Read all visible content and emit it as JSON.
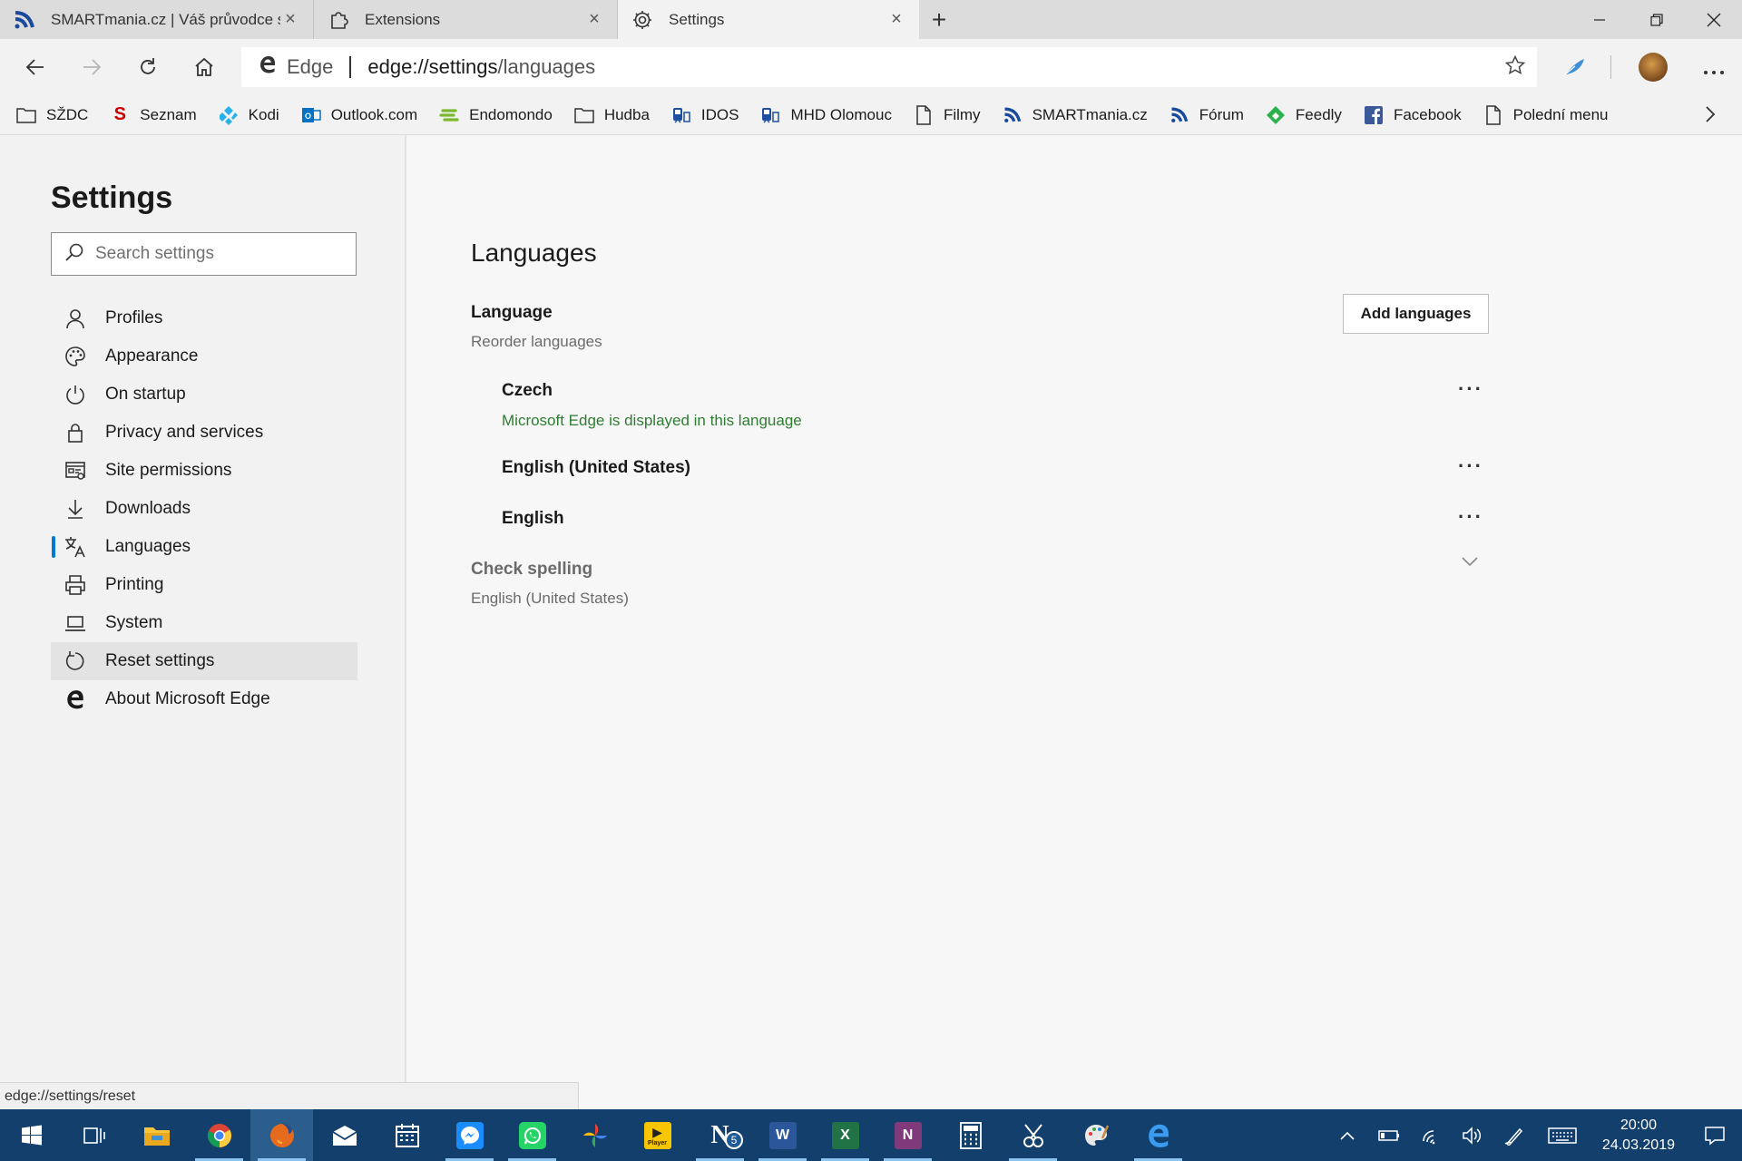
{
  "tabs": [
    {
      "title": "SMARTmania.cz | Váš průvodce s",
      "icon": "smartmania-icon",
      "active": false
    },
    {
      "title": "Extensions",
      "icon": "puzzle-icon",
      "active": false
    },
    {
      "title": "Settings",
      "icon": "gear-icon",
      "active": true
    }
  ],
  "tab_close_glyph": "×",
  "new_tab_glyph": "+",
  "address_bar": {
    "identity_label": "Edge",
    "url_host": "edge://settings",
    "url_path": "/languages"
  },
  "favorites": [
    {
      "label": "SŽDC",
      "icon": "folder-icon"
    },
    {
      "label": "Seznam",
      "icon": "seznam-icon",
      "color": "#cc0000"
    },
    {
      "label": "Kodi",
      "icon": "kodi-icon",
      "color": "#2ab0e8"
    },
    {
      "label": "Outlook.com",
      "icon": "outlook-icon",
      "color": "#0072c6"
    },
    {
      "label": "Endomondo",
      "icon": "endomondo-icon",
      "color": "#7cb82f"
    },
    {
      "label": "Hudba",
      "icon": "folder-icon"
    },
    {
      "label": "IDOS",
      "icon": "idos-icon",
      "color": "#1e4fa0"
    },
    {
      "label": "MHD Olomouc",
      "icon": "bus-icon",
      "color": "#1e4fa0"
    },
    {
      "label": "Filmy",
      "icon": "page-icon"
    },
    {
      "label": "SMARTmania.cz",
      "icon": "smartmania-icon",
      "color": "#1a4a9c"
    },
    {
      "label": "Fórum",
      "icon": "smartmania-icon",
      "color": "#1a4a9c"
    },
    {
      "label": "Feedly",
      "icon": "feedly-icon",
      "color": "#2bb24c"
    },
    {
      "label": "Facebook",
      "icon": "facebook-icon",
      "color": "#3b5998"
    },
    {
      "label": "Polední menu",
      "icon": "page-icon"
    }
  ],
  "sidebar": {
    "title": "Settings",
    "search_placeholder": "Search settings",
    "items": [
      {
        "label": "Profiles",
        "icon": "profile-icon"
      },
      {
        "label": "Appearance",
        "icon": "palette-icon"
      },
      {
        "label": "On startup",
        "icon": "power-icon"
      },
      {
        "label": "Privacy and services",
        "icon": "lock-icon"
      },
      {
        "label": "Site permissions",
        "icon": "site-permissions-icon"
      },
      {
        "label": "Downloads",
        "icon": "download-icon"
      },
      {
        "label": "Languages",
        "icon": "languages-icon",
        "selected": true
      },
      {
        "label": "Printing",
        "icon": "printer-icon"
      },
      {
        "label": "System",
        "icon": "laptop-icon"
      },
      {
        "label": "Reset settings",
        "icon": "reset-icon",
        "hovered": true
      },
      {
        "label": "About Microsoft Edge",
        "icon": "edge-icon"
      }
    ]
  },
  "main": {
    "title": "Languages",
    "language_section": {
      "title": "Language",
      "subtitle": "Reorder languages",
      "add_button": "Add languages"
    },
    "languages": [
      {
        "name": "Czech",
        "note": "Microsoft Edge is displayed in this language"
      },
      {
        "name": "English (United States)",
        "note": ""
      },
      {
        "name": "English",
        "note": ""
      }
    ],
    "more_glyph": "···",
    "spell_check": {
      "title": "Check spelling",
      "value": "English (United States)"
    }
  },
  "status_bar": "edge://settings/reset",
  "taskbar": {
    "time": "20:00",
    "date": "24.03.2019",
    "apps": [
      "start-icon",
      "task-view-icon",
      "file-explorer-icon",
      "chrome-icon",
      "firefox-icon",
      "mail-icon",
      "calendar-icon",
      "messenger-icon",
      "whatsapp-icon",
      "photos-icon",
      "plex-icon",
      "onenote-badge-icon",
      "word-icon",
      "excel-icon",
      "onenote-icon",
      "calculator-icon",
      "snip-icon",
      "paint-icon",
      "edge-icon"
    ],
    "onenote_badge": "5"
  },
  "colors": {
    "accent": "#0078d4",
    "success_text": "#2e7d32",
    "taskbar": "#123f6b"
  }
}
